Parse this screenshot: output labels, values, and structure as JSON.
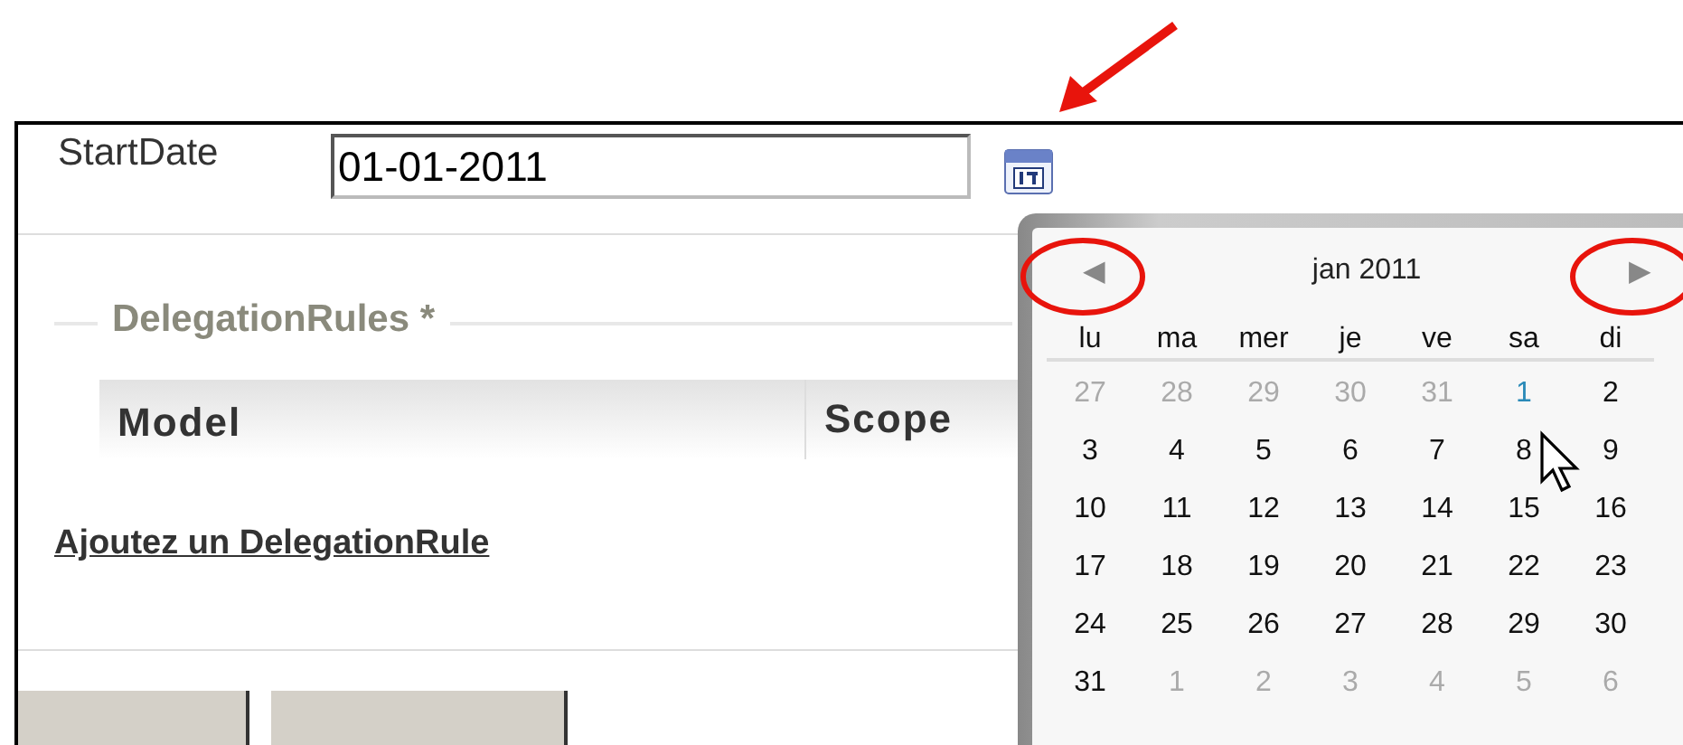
{
  "form": {
    "start_date": {
      "label": "StartDate",
      "value": "01-01-2011"
    }
  },
  "delegation_rules": {
    "legend": "DelegationRules *",
    "columns": [
      "Model",
      "Scope"
    ],
    "add_link": "Ajoutez un DelegationRule"
  },
  "buttons": [
    {
      "kind": "button"
    },
    {
      "kind": "button"
    }
  ],
  "calendar": {
    "prev": "◀",
    "title": "jan 2011",
    "next": "▶",
    "weekdays": [
      "lu",
      "ma",
      "mer",
      "je",
      "ve",
      "sa",
      "di"
    ],
    "weeks": [
      [
        {
          "label": "27",
          "muted": true,
          "selected": false
        },
        {
          "label": "28",
          "muted": true,
          "selected": false
        },
        {
          "label": "29",
          "muted": true,
          "selected": false
        },
        {
          "label": "30",
          "muted": true,
          "selected": false
        },
        {
          "label": "31",
          "muted": true,
          "selected": false
        },
        {
          "label": "1",
          "muted": false,
          "selected": true
        },
        {
          "label": "2",
          "muted": false,
          "selected": false
        }
      ],
      [
        {
          "label": "3",
          "muted": false,
          "selected": false
        },
        {
          "label": "4",
          "muted": false,
          "selected": false
        },
        {
          "label": "5",
          "muted": false,
          "selected": false
        },
        {
          "label": "6",
          "muted": false,
          "selected": false
        },
        {
          "label": "7",
          "muted": false,
          "selected": false
        },
        {
          "label": "8",
          "muted": false,
          "selected": false
        },
        {
          "label": "9",
          "muted": false,
          "selected": false
        }
      ],
      [
        {
          "label": "10",
          "muted": false,
          "selected": false
        },
        {
          "label": "11",
          "muted": false,
          "selected": false
        },
        {
          "label": "12",
          "muted": false,
          "selected": false
        },
        {
          "label": "13",
          "muted": false,
          "selected": false
        },
        {
          "label": "14",
          "muted": false,
          "selected": false
        },
        {
          "label": "15",
          "muted": false,
          "selected": false
        },
        {
          "label": "16",
          "muted": false,
          "selected": false
        }
      ],
      [
        {
          "label": "17",
          "muted": false,
          "selected": false
        },
        {
          "label": "18",
          "muted": false,
          "selected": false
        },
        {
          "label": "19",
          "muted": false,
          "selected": false
        },
        {
          "label": "20",
          "muted": false,
          "selected": false
        },
        {
          "label": "21",
          "muted": false,
          "selected": false
        },
        {
          "label": "22",
          "muted": false,
          "selected": false
        },
        {
          "label": "23",
          "muted": false,
          "selected": false
        }
      ],
      [
        {
          "label": "24",
          "muted": false,
          "selected": false
        },
        {
          "label": "25",
          "muted": false,
          "selected": false
        },
        {
          "label": "26",
          "muted": false,
          "selected": false
        },
        {
          "label": "27",
          "muted": false,
          "selected": false
        },
        {
          "label": "28",
          "muted": false,
          "selected": false
        },
        {
          "label": "29",
          "muted": false,
          "selected": false
        },
        {
          "label": "30",
          "muted": false,
          "selected": false
        }
      ],
      [
        {
          "label": "31",
          "muted": false,
          "selected": false
        },
        {
          "label": "1",
          "muted": true,
          "selected": false
        },
        {
          "label": "2",
          "muted": true,
          "selected": false
        },
        {
          "label": "3",
          "muted": true,
          "selected": false
        },
        {
          "label": "4",
          "muted": true,
          "selected": false
        },
        {
          "label": "5",
          "muted": true,
          "selected": false
        },
        {
          "label": "6",
          "muted": true,
          "selected": false
        }
      ]
    ]
  }
}
